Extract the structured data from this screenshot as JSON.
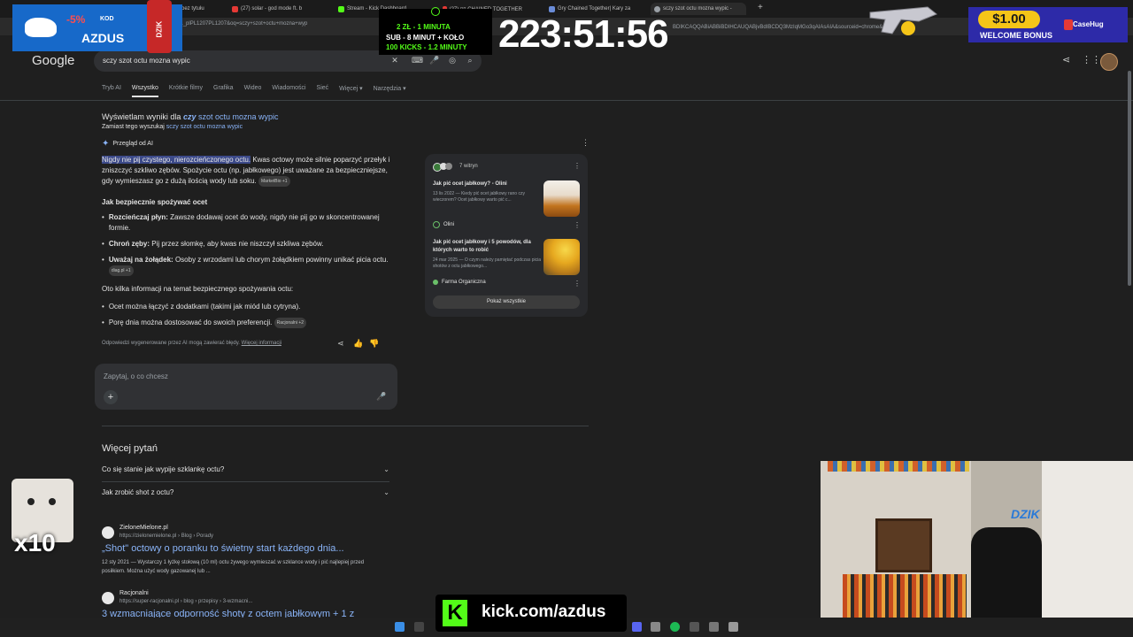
{
  "browser": {
    "tabs": [
      {
        "label": "bez tytułu"
      },
      {
        "label": "(27) solar - god mode ft. b"
      },
      {
        "label": "Stream - Kick Dashboard"
      },
      {
        "label": "(27) ▯▯ CHAINED TOGETHER"
      },
      {
        "label": "Gry Chained Together| Kary za"
      },
      {
        "label": "sczy szot octu mozna wypic - "
      }
    ],
    "url_left": "mozna+wypic&rlz=1C1HKFL_plPL1207PL1207&oq=sczy+szot+octu+mozna+wyp",
    "url_right": "BDIKCAQQABiABBiBDIHCAUQABjvBdIBCDQ3MzIqMGo3qAIAsAIA&sourceid=chrome&..."
  },
  "google": {
    "logo": "Google",
    "query": "sczy szot octu mozna wypic",
    "nav_tabs": [
      "Tryb AI",
      "Wszystko",
      "Krótkie filmy",
      "Grafika",
      "Wideo",
      "Wiadomości",
      "Sieć",
      "Więcej ▾",
      "Narzędzia ▾"
    ],
    "active_tab": "Wszystko"
  },
  "spell": {
    "showing_prefix": "Wyświetlam wyniki dla ",
    "showing_corrected_em": "czy",
    "showing_corrected_rest": " szot octu mozna wypic",
    "instead_prefix": "Zamiast tego wyszukaj ",
    "instead_link": "sczy szot octu mozna wypic"
  },
  "ai_overview": {
    "label": "Przegląd od AI",
    "intro_highlight": "Nigdy nie pij czystego, nierozcieńczonego octu.",
    "intro_rest": " Kwas octowy może silnie poparzyć przełyk i zniszczyć szkliwo zębów. Spożycie octu (np. jabłkowego) jest uważane za bezpieczniejsze, gdy wymieszasz go z dużą ilością wody lub soku.",
    "intro_chip": "MarketBio +1",
    "heading": "Jak bezpiecznie spożywać ocet",
    "bullets": [
      {
        "bold": "Rozcieńczaj płyn:",
        "text": " Zawsze dodawaj ocet do wody, nigdy nie pij go w skoncentrowanej formie.",
        "chip": ""
      },
      {
        "bold": "Chroń zęby:",
        "text": " Pij przez słomkę, aby kwas nie niszczył szkliwa zębów.",
        "chip": ""
      },
      {
        "bold": "Uważaj na żołądek:",
        "text": " Osoby z wrzodami lub chorym żołądkiem powinny unikać picia octu.",
        "chip": "diag.pl +1"
      }
    ],
    "info_heading": "Oto kilka informacji na temat bezpiecznego spożywania octu:",
    "info_bullets": [
      {
        "text": "Ocet można łączyć z dodatkami (takimi jak miód lub cytryna).",
        "chip": ""
      },
      {
        "text": "Porę dnia można dostosować do swoich preferencji.",
        "chip": "Racjonalni +2"
      }
    ],
    "disclaimer": "Odpowiedzi wygenerowane przez AI mogą zawierać błędy.",
    "disclaimer_link": "Więcej informacji"
  },
  "sources_card": {
    "count_label": "7 witryn",
    "items": [
      {
        "title": "Jak pić ocet jabłkowy? - Olini",
        "snippet": "13 lis 2022 — Kiedy pić ocet jabłkowy rano czy wieczorem? Ocet jabłkowy warto pić c...",
        "source": "Olini"
      },
      {
        "title": "Jak pić ocet jabłkowy i 5 powodów, dla których warto to robić",
        "snippet": "24 mar 2025 — O czym należy pamiętać podczas picia shotów z octu jabłkowego...",
        "source": "Farma Organiczna"
      }
    ],
    "show_all": "Pokaż wszystkie"
  },
  "ask_box": {
    "placeholder": "Zapytaj, o co chcesz"
  },
  "paa": {
    "heading": "Więcej pytań",
    "questions": [
      "Co się stanie jak wypije szklankę octu?",
      "Jak zrobić shot z octu?"
    ]
  },
  "results": [
    {
      "site": "ZieloneMielone.pl",
      "url": "https://zielonemielone.pl › Blog › Porady",
      "title": "„Shot\" octowy o poranku to świetny start każdego dnia...",
      "snippet": "12 sty 2021 — Wystarczy 1 łyżkę stołową (10 ml) octu żywego wymieszać w szklance wody i pić najlepiej przed posiłkiem. Można użyć wody gazowanej lub ..."
    },
    {
      "site": "Racjonalni",
      "url": "https://super-racjonalni.pl › blog › przepisy › 3-wzmacni...",
      "title": "3 wzmacniające odporność shoty z octem jabłkowym + 1 z"
    }
  ],
  "overlay": {
    "promo_discount": "-5%",
    "promo_kod": "KOD",
    "promo_code": "AZDUS",
    "can_label": "DZIK",
    "timer_lines": [
      "2 ZŁ - 1 MINUTA",
      "SUB - 8 MINUT + KOŁO",
      "100 KICKS - 1.2 MINUTY"
    ],
    "big_timer": "223:51:56",
    "bonus_amount": "$1.00",
    "bonus_label": "WELCOME BONUS",
    "casehug": "CaseHug",
    "multiplier": "x10",
    "kick_url": "kick.com/azdus",
    "webcam_logo": "DZIK"
  },
  "colors": {
    "link": "#8ab4f8",
    "kick_green": "#53fc18",
    "bg": "#1f1f1f"
  }
}
